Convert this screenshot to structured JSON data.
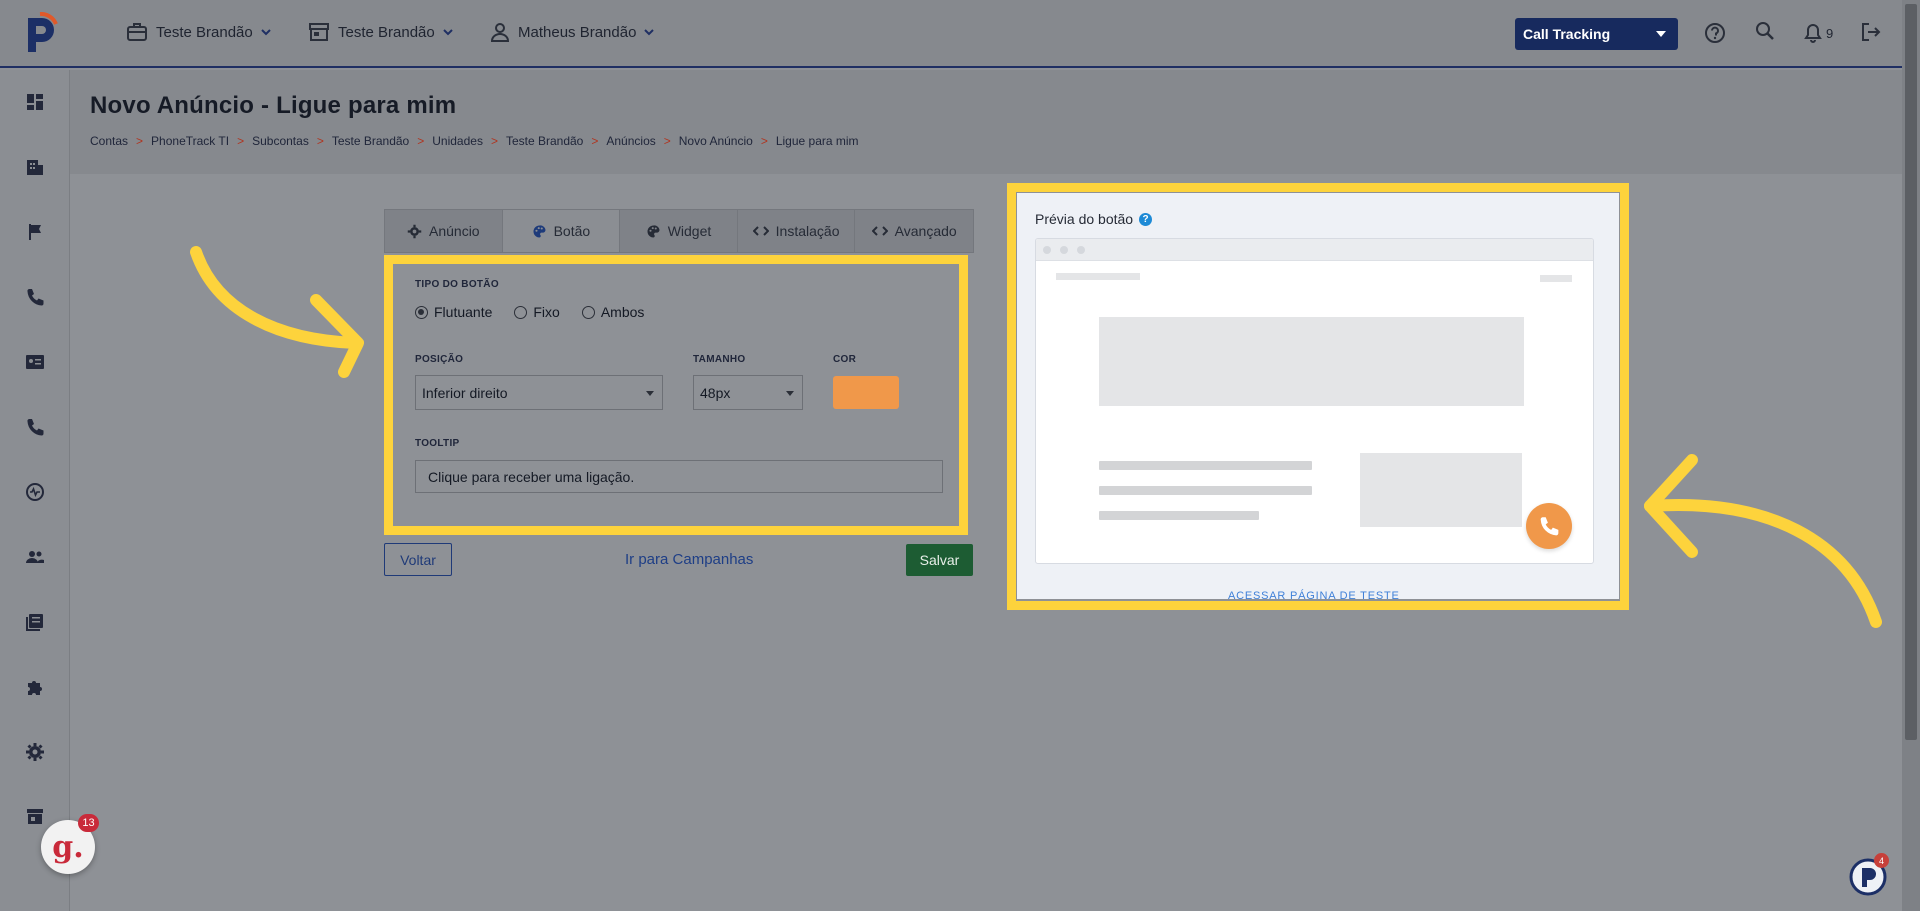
{
  "topbar": {
    "account": "Teste Brandão",
    "store": "Teste Brandão",
    "user": "Matheus Brandão",
    "product_button": "Call Tracking",
    "notifications_count": "9"
  },
  "page": {
    "title": "Novo Anúncio - Ligue para mim",
    "breadcrumb": [
      "Contas",
      "PhoneTrack TI",
      "Subcontas",
      "Teste Brandão",
      "Unidades",
      "Teste Brandão",
      "Anúncios",
      "Novo Anúncio",
      "Ligue para mim"
    ],
    "breadcrumb_separator": ">"
  },
  "tabs": [
    {
      "label": "Anúncio",
      "icon": "gear-icon"
    },
    {
      "label": "Botão",
      "icon": "palette-icon",
      "active": true
    },
    {
      "label": "Widget",
      "icon": "palette-icon"
    },
    {
      "label": "Instalação",
      "icon": "code-icon"
    },
    {
      "label": "Avançado",
      "icon": "code-icon"
    }
  ],
  "form": {
    "button_type_label": "TIPO DO BOTÃO",
    "button_type_options": [
      "Flutuante",
      "Fixo",
      "Ambos"
    ],
    "button_type_selected": "Flutuante",
    "position_label": "POSIÇÃO",
    "position_value": "Inferior direito",
    "size_label": "TAMANHO",
    "size_value": "48px",
    "color_label": "COR",
    "color_value": "#f0984a",
    "tooltip_label": "TOOLTIP",
    "tooltip_value": "Clique para receber uma ligação."
  },
  "actions": {
    "back": "Voltar",
    "campaigns_link": "Ir para Campanhas",
    "save": "Salvar"
  },
  "preview": {
    "title": "Prévia do botão",
    "test_link": "ACESSAR PÁGINA DE TESTE"
  },
  "badges": {
    "g_count": "13",
    "pt_count": "4"
  },
  "colors": {
    "highlight": "#fdd33c",
    "primary": "#172a5e",
    "save": "#1d5c33",
    "button_color": "#f0984a"
  }
}
